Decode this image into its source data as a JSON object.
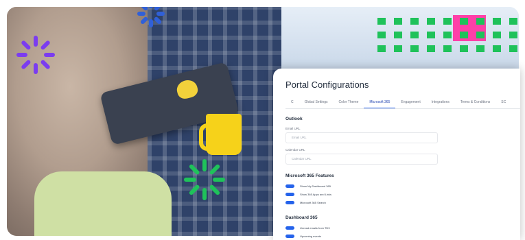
{
  "portal": {
    "title": "Portal Configurations",
    "tabs": [
      {
        "label": "C"
      },
      {
        "label": "Global Settings"
      },
      {
        "label": "Color Theme"
      },
      {
        "label": "Microsoft 365"
      },
      {
        "label": "Engagement"
      },
      {
        "label": "Integrations"
      },
      {
        "label": "Terms & Conditions"
      },
      {
        "label": "SC"
      }
    ],
    "active_tab": "Microsoft 365",
    "outlook": {
      "section_title": "Outlook",
      "email_label": "Email URL",
      "email_placeholder": "Email URL",
      "calendar_label": "Calendar URL",
      "calendar_placeholder": "Calendar URL"
    },
    "features": {
      "section_title": "Microsoft 365 Features",
      "toggles": [
        {
          "label": "Show My Dashboard 365"
        },
        {
          "label": "Show 365 Apps and Links"
        },
        {
          "label": "Microsoft 365 Search"
        }
      ]
    },
    "dashboard": {
      "section_title": "Dashboard 365",
      "toggles": [
        {
          "label": "Unread emails from TDX"
        },
        {
          "label": "Upcoming events"
        }
      ]
    }
  },
  "colors": {
    "accent": "#2563eb",
    "burst_purple": "#7b3cf0",
    "burst_green": "#1fc25a",
    "burst_blue": "#3060d8",
    "mug": "#f6d21a",
    "pink": "#ff3fa8"
  }
}
